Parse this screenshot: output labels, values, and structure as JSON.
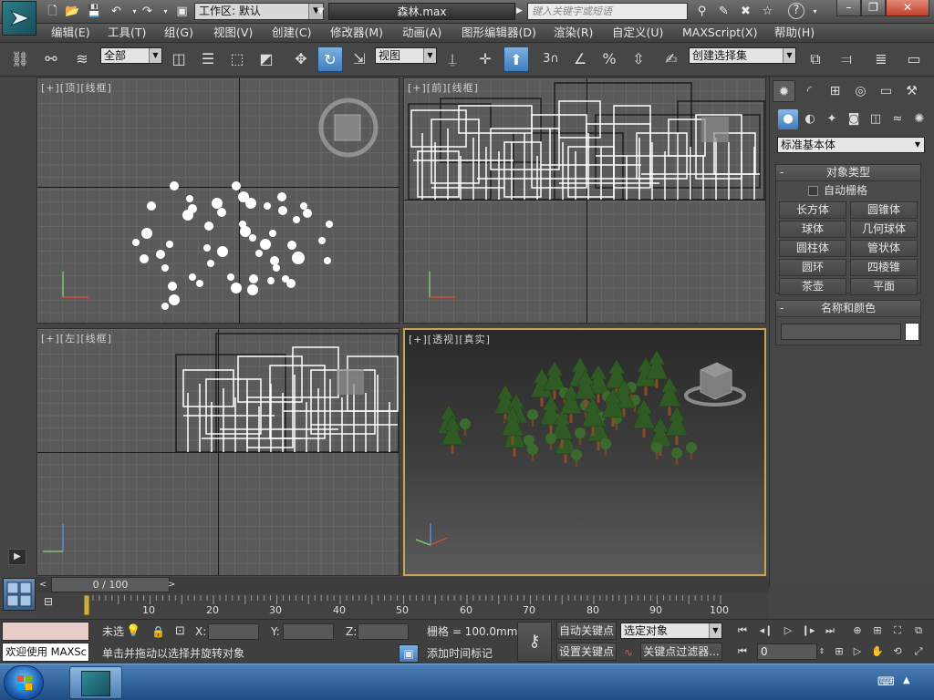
{
  "title": {
    "workspace_label": "工作区: 默认",
    "file_name": "森林.max",
    "search_placeholder": "键入关键字或短语"
  },
  "menu": [
    "编辑(E)",
    "工具(T)",
    "组(G)",
    "视图(V)",
    "创建(C)",
    "修改器(M)",
    "动画(A)",
    "图形编辑器(D)",
    "渲染(R)",
    "自定义(U)",
    "MAXScript(X)",
    "帮助(H)"
  ],
  "toolbar": {
    "selection_filter": "全部",
    "reference_coord": "视图",
    "named_selection_placeholder": "创建选择集",
    "snap_label": "3"
  },
  "viewports": {
    "top": "[+][顶][线框]",
    "front": "[+][前][线框]",
    "left": "[+][左][线框]",
    "perspective": "[+][透视][真实]"
  },
  "command_panel": {
    "category": "标准基本体",
    "object_type_title": "对象类型",
    "auto_grid": "自动栅格",
    "buttons": [
      "长方体",
      "圆锥体",
      "球体",
      "几何球体",
      "圆柱体",
      "管状体",
      "圆环",
      "四棱锥",
      "茶壶",
      "平面"
    ],
    "name_color_title": "名称和颜色"
  },
  "timeline": {
    "frame_display": "0 / 100",
    "ticks": [
      "10",
      "20",
      "30",
      "40",
      "50",
      "60",
      "70",
      "80",
      "90",
      "100"
    ]
  },
  "status": {
    "maxscript_text": "欢迎使用 MAXSc",
    "selection_status": "未选",
    "x_label": "X:",
    "y_label": "Y:",
    "z_label": "Z:",
    "grid_text": "栅格 = 100.0mm",
    "prompt": "单击并拖动以选择并旋转对象",
    "add_time_tag": "添加时间标记",
    "auto_key": "自动关键点",
    "set_key": "设置关键点",
    "key_mode_select": "选定对象",
    "key_filters": "关键点过滤器...",
    "current_frame": "0"
  },
  "colors": {
    "accent": "#3d7dbd",
    "viewport_bg": "#5a5a5a",
    "persp_border": "#c9a64a",
    "tree_dark": "#2f5a23",
    "trunk": "#8a4a22"
  }
}
